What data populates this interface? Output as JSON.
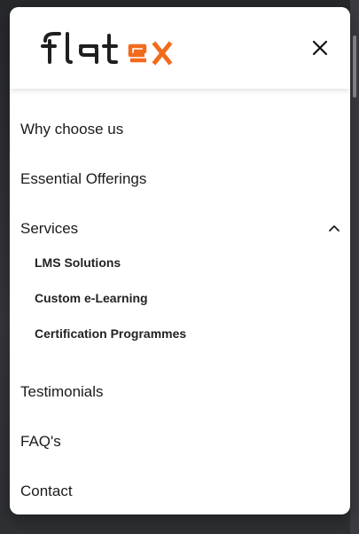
{
  "brand": {
    "logo_text_dark": "flat",
    "logo_text_accent": "ex",
    "accent_color": "#f26b1d",
    "dark_color": "#1f1f1f"
  },
  "header": {
    "close_icon": "close-icon"
  },
  "menu": {
    "items": [
      {
        "label": "Why choose us"
      },
      {
        "label": "Essential Offerings"
      },
      {
        "label": "Services",
        "expanded": true,
        "icon": "chevron-up-icon",
        "children": [
          {
            "label": "LMS Solutions"
          },
          {
            "label": "Custom e-Learning"
          },
          {
            "label": "Certification Programmes"
          }
        ]
      },
      {
        "label": "Testimonials"
      },
      {
        "label": "FAQ's"
      },
      {
        "label": "Contact"
      }
    ]
  }
}
